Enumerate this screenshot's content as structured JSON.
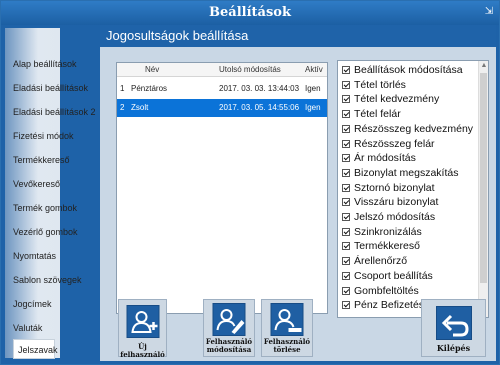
{
  "window": {
    "title": "Beállítások",
    "close_label": "⇲"
  },
  "sidebar": {
    "items": [
      "Alap beállítások",
      "Eladási beállítások",
      "Eladási beállítások 2",
      "Fizetési módok",
      "Termékkereső",
      "Vevőkereső",
      "Termék gombok",
      "Vezérlő gombok",
      "Nyomtatás",
      "Sablon szövegek",
      "Jogcímek",
      "Valuták",
      "Jelszavak"
    ],
    "active_index": 12
  },
  "main": {
    "title": "Jogosultságok beállítása"
  },
  "users_table": {
    "columns": [
      "Név",
      "Utolsó módosítás",
      "Aktív"
    ],
    "rows": [
      {
        "id": "1",
        "name": "Pénztáros",
        "modified": "2017. 03. 03. 13:44:03",
        "active": "Igen",
        "selected": false
      },
      {
        "id": "2",
        "name": "Zsolt",
        "modified": "2017. 03. 05. 14:55:06",
        "active": "Igen",
        "selected": true
      }
    ]
  },
  "permissions": [
    "Beállítások módosítása",
    "Tétel törlés",
    "Tétel kedvezmény",
    "Tétel felár",
    "Részösszeg kedvezmény",
    "Részösszeg felár",
    "Ár módosítás",
    "Bizonylat megszakítás",
    "Sztornó bizonylat",
    "Visszáru bizonylat",
    "Jelszó módosítás",
    "Szinkronizálás",
    "Termékkereső",
    "Árellenőrző",
    "Csoport beállítás",
    "Gombfeltöltés",
    "Pénz Befizetés"
  ],
  "buttons": {
    "new_user": "Új felhasználó",
    "edit_user_line1": "Felhasználó",
    "edit_user_line2": "módosítása",
    "delete_user_line1": "Felhasználó",
    "delete_user_line2": "törlése",
    "exit": "Kilépés"
  },
  "colors": {
    "title_bar": "#1f63a9",
    "selected_row": "#0b73d8",
    "button_icon": "#1f5fa3"
  }
}
